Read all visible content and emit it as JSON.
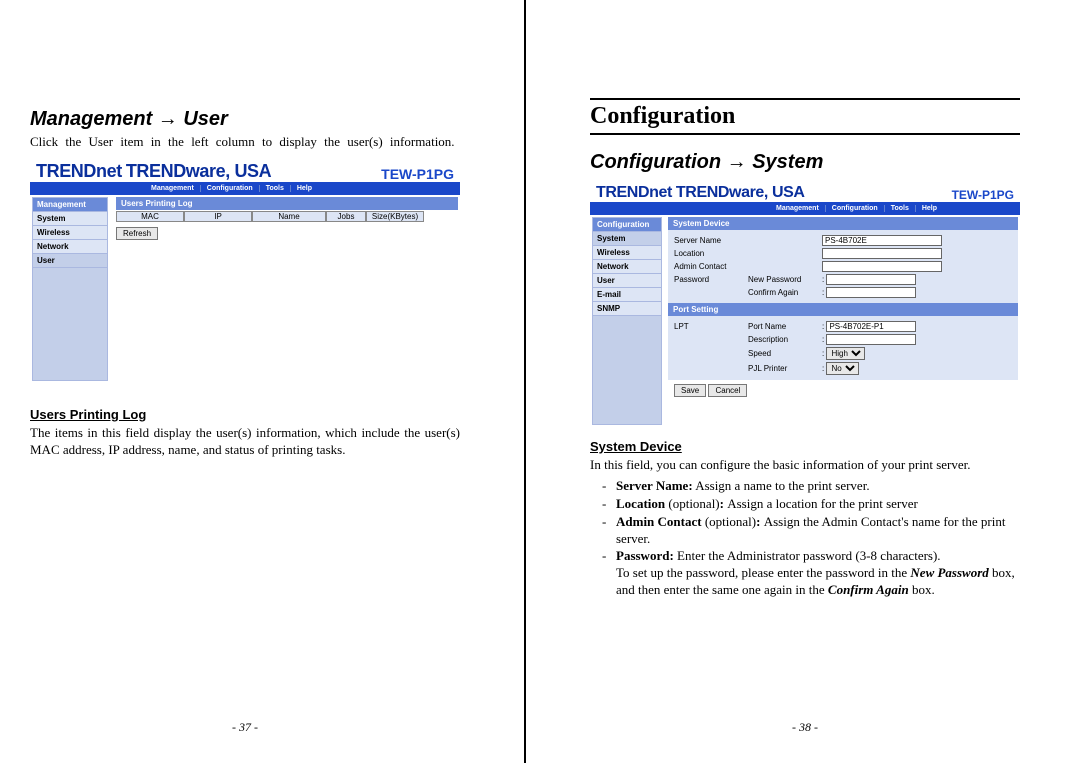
{
  "left": {
    "section_title": "Management → User",
    "intro": "Click the User item in the left column to display the user(s) information.",
    "brand": "TRENDnet",
    "brand_sub": "TRENDware, USA",
    "model": "TEW-P1PG",
    "nav": [
      "Management",
      "Configuration",
      "Tools",
      "Help"
    ],
    "sidebar_head": "Management",
    "sidebar_items": [
      "System",
      "Wireless",
      "Network",
      "User"
    ],
    "sidebar_active": "User",
    "log_head": "Users Printing Log",
    "log_cols": [
      "MAC",
      "IP",
      "Name",
      "Jobs",
      "Size(KBytes)"
    ],
    "refresh": "Refresh",
    "subhead": "Users Printing Log",
    "desc": "The items in this field display the user(s) information, which include the user(s) MAC address, IP address, name, and status of printing tasks.",
    "page_num": "- 37 -"
  },
  "right": {
    "page_title": "Configuration",
    "section_title": "Configuration → System",
    "brand": "TRENDnet",
    "brand_sub": "TRENDware, USA",
    "model": "TEW-P1PG",
    "nav": [
      "Management",
      "Configuration",
      "Tools",
      "Help"
    ],
    "sidebar_head": "Configuration",
    "sidebar_items": [
      "System",
      "Wireless",
      "Network",
      "User",
      "E-mail",
      "SNMP"
    ],
    "sidebar_active": "System",
    "form": {
      "section1": "System Device",
      "server_name_label": "Server Name",
      "server_name_value": "PS-4B702E",
      "location_label": "Location",
      "admin_label": "Admin Contact",
      "password_label": "Password",
      "new_pw_label": "New Password",
      "confirm_label": "Confirm Again",
      "section2": "Port Setting",
      "lpt_label": "LPT",
      "port_name_label": "Port Name",
      "port_name_value": "PS-4B702E-P1",
      "desc_label": "Description",
      "speed_label": "Speed",
      "speed_value": "High",
      "pjl_label": "PJL Printer",
      "pjl_value": "No",
      "save": "Save",
      "cancel": "Cancel"
    },
    "subhead": "System Device",
    "desc": "In this field, you can configure the basic information of your print server.",
    "b1_a": "Server Name:",
    "b1_b": " Assign a name to the print server.",
    "b2_a": "Location",
    "b2_b": " (optional)",
    "b2_c": ": ",
    "b2_d": "Assign a location for the print server",
    "b3_a": "Admin Contact",
    "b3_b": " (optional)",
    "b3_c": ": ",
    "b3_d": "Assign the Admin Contact's name for the print server.",
    "b4_a": "Password:",
    "b4_b": " Enter the Administrator password (3-8 characters).",
    "b4_c": "To set up the password, please enter the password in the ",
    "b4_d": "New Password",
    "b4_e": " box, and then enter the same one again in the ",
    "b4_f": "Confirm Again",
    "b4_g": " box.",
    "page_num": "- 38 -"
  }
}
